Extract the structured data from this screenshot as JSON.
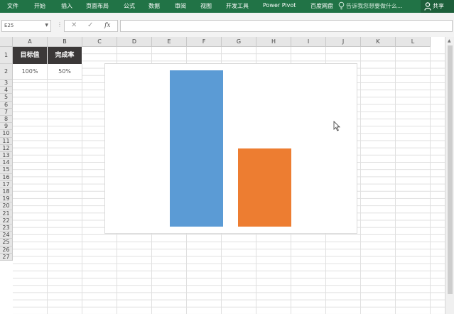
{
  "ribbon": {
    "tabs": [
      "文件",
      "开始",
      "插入",
      "页面布局",
      "公式",
      "数据",
      "审阅",
      "视图",
      "开发工具",
      "Power Pivot",
      "百度网盘"
    ],
    "tell_me": "告诉我您想要做什么...",
    "share": "共享",
    "color": "#217346"
  },
  "formula_bar": {
    "name_box": "E25",
    "formula": ""
  },
  "columns": [
    "A",
    "B",
    "C",
    "D",
    "E",
    "F",
    "G",
    "H",
    "I",
    "J",
    "K",
    "L"
  ],
  "rows": [
    "1",
    "2",
    "3",
    "4",
    "5",
    "6",
    "7",
    "8",
    "9",
    "10",
    "11",
    "12",
    "13",
    "14",
    "15",
    "16",
    "17",
    "18",
    "19",
    "20",
    "21",
    "22",
    "23",
    "24",
    "25",
    "26",
    "27"
  ],
  "table": {
    "headers": [
      "目标值",
      "完成率"
    ],
    "values": [
      "100%",
      "50%"
    ]
  },
  "chart_data": {
    "type": "bar",
    "series": [
      {
        "values": [
          1.0
        ],
        "color": "#5b9bd5"
      },
      {
        "values": [
          0.5
        ],
        "color": "#ed7d31"
      }
    ],
    "ylim": [
      0,
      1
    ],
    "legend": "none",
    "grid": false
  }
}
